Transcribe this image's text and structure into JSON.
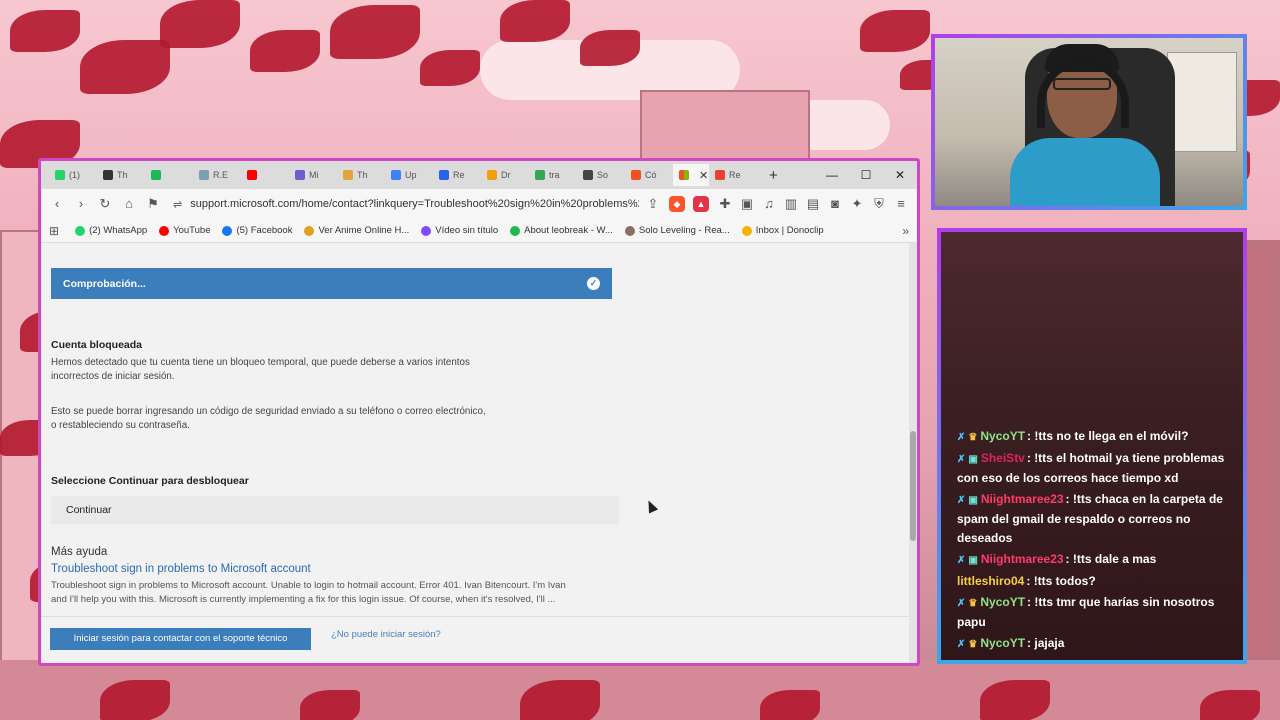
{
  "browser": {
    "tabs": [
      {
        "label": "(1)",
        "color": "#25d366"
      },
      {
        "label": "Th",
        "color": "#333333"
      },
      {
        "label": "",
        "color": "#1db954"
      },
      {
        "label": "R.E",
        "color": "#7aa0b3"
      },
      {
        "label": "",
        "color": "#ff0000"
      },
      {
        "label": "Mi",
        "color": "#6c5dd3"
      },
      {
        "label": "Th",
        "color": "#e6a23c"
      },
      {
        "label": "Up",
        "color": "#3b82f6"
      },
      {
        "label": "Re",
        "color": "#2563eb"
      },
      {
        "label": "Dr",
        "color": "#f59e0b"
      },
      {
        "label": "tra",
        "color": "#34a853"
      },
      {
        "label": "So",
        "color": "#444444"
      },
      {
        "label": "Có",
        "color": "#f25022"
      }
    ],
    "last_tab": {
      "label": "Re",
      "color": "#ea4335"
    },
    "new_tab_label": "+",
    "window_controls": [
      "—",
      "☐",
      "✕"
    ],
    "url": "support.microsoft.com/home/contact?linkquery=Troubleshoot%20sign%20in%20problems%20t...",
    "bookmarks": [
      {
        "label": "(2) WhatsApp",
        "color": "#25d366"
      },
      {
        "label": "YouTube",
        "color": "#ff0000"
      },
      {
        "label": "(5) Facebook",
        "color": "#1877f2"
      },
      {
        "label": "Ver Anime Online H...",
        "color": "#e0a020"
      },
      {
        "label": "Vídeo sin título",
        "color": "#7c4dff"
      },
      {
        "label": "About leobreak - W...",
        "color": "#1db954"
      },
      {
        "label": "Solo Leveling - Rea...",
        "color": "#8d6e63"
      },
      {
        "label": "Inbox | Donoclip",
        "color": "#f4b400"
      }
    ]
  },
  "page": {
    "status_label": "Comprobación...",
    "locked_title": "Cuenta bloqueada",
    "locked_p1_line1": "Hemos detectado que tu cuenta tiene un bloqueo temporal, que puede deberse a varios intentos",
    "locked_p1_line2": "incorrectos de iniciar sesión.",
    "locked_p2_line1": "Esto se puede borrar ingresando un código de seguridad enviado a su teléfono o correo electrónico,",
    "locked_p2_line2": "o restableciendo su contraseña.",
    "select_title": "Seleccione Continuar para desbloquear",
    "continue_label": "Continuar",
    "more_help": "Más ayuda",
    "help_link": "Troubleshoot sign in problems to Microsoft account",
    "help_desc_line1": "Troubleshoot sign in problems to Microsoft account. Unable to login to hotmail account. Error 401. Ivan Bitencourt. I'm Ivan",
    "help_desc_line2": "and I'll help you with this. Microsoft is currently implementing a fix for this login issue. Of course, when it's resolved, I'll ...",
    "signin_button": "Iniciar sesión para contactar con el soporte técnico",
    "cant_signin": "¿No puede iniciar sesión?"
  },
  "chat": {
    "messages": [
      {
        "badges": [
          "sword",
          "crown"
        ],
        "user": "NycoYT",
        "user_color": "#8fe388",
        "text": ": !tts no te llega en el móvil?"
      },
      {
        "badges": [
          "sword",
          "bot"
        ],
        "user": "SheiStv",
        "user_color": "#e0245e",
        "text": ": !tts el hotmail ya tiene problemas con eso de los correos hace tiempo xd"
      },
      {
        "badges": [
          "sword",
          "bot"
        ],
        "user": "Niightmaree23",
        "user_color": "#ff3b6b",
        "text": ": !tts chaca en la carpeta de spam del gmail de respaldo o correos no deseados"
      },
      {
        "badges": [
          "sword",
          "bot"
        ],
        "user": "Niightmaree23",
        "user_color": "#ff3b6b",
        "text": ": !tts dale a mas"
      },
      {
        "badges": [],
        "user": "littleshiro04",
        "user_color": "#f5d142",
        "text": ": !tts todos?"
      },
      {
        "badges": [
          "sword",
          "crown"
        ],
        "user": "NycoYT",
        "user_color": "#8fe388",
        "text": ": !tts tmr que harías sin nosotros papu"
      },
      {
        "badges": [
          "sword",
          "crown"
        ],
        "user": "NycoYT",
        "user_color": "#8fe388",
        "text": ": jajaja"
      }
    ]
  }
}
